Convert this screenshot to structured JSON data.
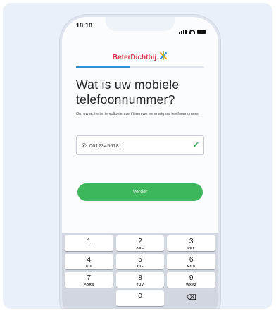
{
  "status": {
    "time": "18:18"
  },
  "header": {
    "logo_text": "BeterDichtbij",
    "logo_mark": "✲"
  },
  "form": {
    "progress": 0.42,
    "title": "Wat is uw mobiele telefoonnummer?",
    "subtitle": "Om uw activatie te voltooien verifiëren we eenmalig uw telefoonnummer",
    "phone_value": "0612345678",
    "phone_icon": "phone-icon",
    "check_icon": "check-icon",
    "next_label": "Verder"
  },
  "keyboard": {
    "keys": [
      {
        "digit": "1",
        "letters": ""
      },
      {
        "digit": "2",
        "letters": "ABC"
      },
      {
        "digit": "3",
        "letters": "DEF"
      },
      {
        "digit": "4",
        "letters": "GHI"
      },
      {
        "digit": "5",
        "letters": "JKL"
      },
      {
        "digit": "6",
        "letters": "MNO"
      },
      {
        "digit": "7",
        "letters": "PQRS"
      },
      {
        "digit": "8",
        "letters": "TUV"
      },
      {
        "digit": "9",
        "letters": "WXYZ"
      },
      {
        "digit": "0",
        "letters": ""
      }
    ],
    "backspace_glyph": "⌫"
  },
  "colors": {
    "accent_green": "#3db65c",
    "brand_red": "#d6364f",
    "progress_blue": "#2e8fd1"
  }
}
